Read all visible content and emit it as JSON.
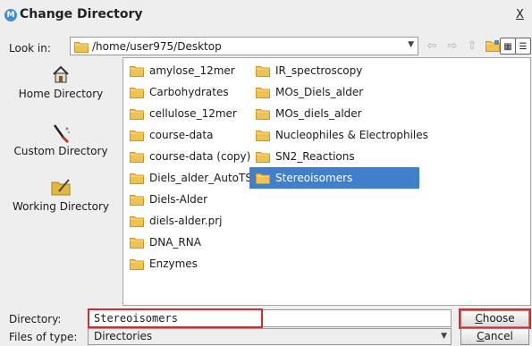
{
  "window": {
    "title": "Change Directory",
    "close_label": "X",
    "app_icon": "M"
  },
  "lookin": {
    "label": "Look in:",
    "path": "/home/user975/Desktop"
  },
  "toolbar": {
    "back_glyph": "⇦",
    "forward_glyph": "⇨",
    "up_glyph": "⇧"
  },
  "places": [
    {
      "label": "Home Directory",
      "icon": "house-icon"
    },
    {
      "label": "Custom Directory",
      "icon": "brush-icon"
    },
    {
      "label": "Working Directory",
      "icon": "pencil-folder-icon"
    }
  ],
  "files": {
    "column1": [
      "amylose_12mer",
      "Carbohydrates",
      "cellulose_12mer",
      "course-data",
      "course-data (copy)",
      "Diels_alder_AutoTS",
      "Diels-Alder",
      "diels-alder.prj",
      "DNA_RNA",
      "Enzymes"
    ],
    "column2": [
      "IR_spectroscopy",
      "MOs_Diels_alder",
      "MOs_diels_alder",
      "Nucleophiles & Electrophiles",
      "SN2_Reactions",
      "Stereoisomers"
    ],
    "selected": "Stereoisomers"
  },
  "directory": {
    "label": "Directory:",
    "value": "Stereoisomers"
  },
  "filetype": {
    "label": "Files of type:",
    "value": "Directories"
  },
  "buttons": {
    "choose": {
      "mnemonic": "C",
      "rest": "hoose"
    },
    "cancel": {
      "mnemonic": "C",
      "rest": "ancel"
    }
  },
  "colors": {
    "selection": "#3f7fcc",
    "highlight": "#d82a2a",
    "folder": "#f0c24f"
  }
}
